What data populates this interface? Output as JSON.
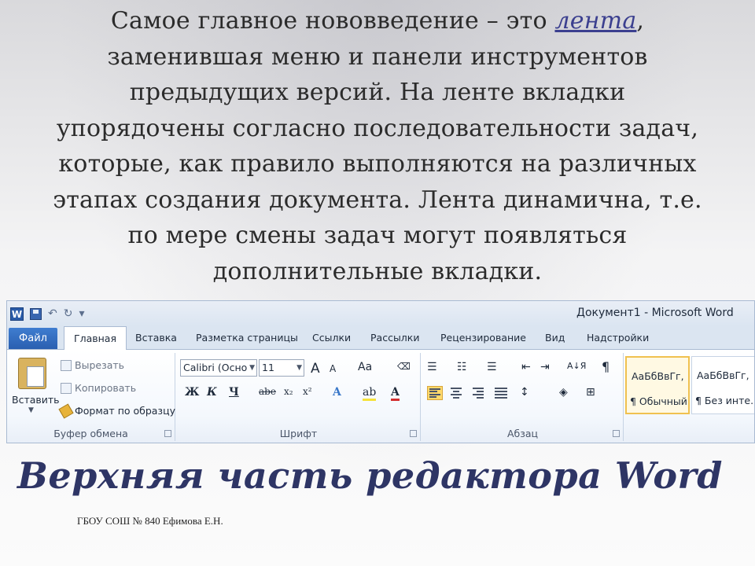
{
  "slide": {
    "intro_lines": [
      {
        "before": "Самое главное нововведение – это ",
        "link": "лента",
        "after": ","
      },
      {
        "text": "заменившая меню и панели инструментов"
      },
      {
        "text": "предыдущих версий. На ленте вкладки"
      },
      {
        "text": "упорядочены согласно последовательности задач,"
      },
      {
        "text": "которые, как правило выполняются на различных"
      },
      {
        "text": "этапах создания документа. Лента динамична, т.е."
      },
      {
        "text": "по мере смены задач могут появляться"
      },
      {
        "text": "дополнительные вкладки."
      }
    ],
    "caption": "Верхняя часть редактора Word",
    "footer": "ГБОУ СОШ № 840 Ефимова Е.Н."
  },
  "word": {
    "app_icon_letter": "W",
    "window_title": "Документ1 - Microsoft Word",
    "tabs": {
      "file": "Файл",
      "home": "Главная",
      "others": [
        "Вставка",
        "Разметка страницы",
        "Ссылки",
        "Рассылки",
        "Рецензирование",
        "Вид",
        "Надстройки"
      ]
    },
    "clipboard": {
      "paste": "Вставить",
      "cut": "Вырезать",
      "copy": "Копировать",
      "format_painter": "Формат по образцу",
      "group_label": "Буфер обмена"
    },
    "font": {
      "font_name": "Calibri (Осно",
      "font_size": "11",
      "grow": "A",
      "shrink": "A",
      "case": "Aa",
      "bold": "Ж",
      "italic": "К",
      "underline": "Ч",
      "strike": "abe",
      "subscript": "x₂",
      "superscript": "x²",
      "group_label": "Шрифт"
    },
    "paragraph": {
      "sort": "А↓Я",
      "pilcrow": "¶",
      "group_label": "Абзац"
    },
    "styles": [
      {
        "sample": "АаБбВвГг,",
        "name": "¶ Обычный"
      },
      {
        "sample": "АаБбВвГг,",
        "name": "¶ Без инте..."
      }
    ],
    "colors": {
      "file_tab": "#2a5fb0",
      "highlight": "#ffd96b",
      "caption": "#2e3565"
    }
  }
}
